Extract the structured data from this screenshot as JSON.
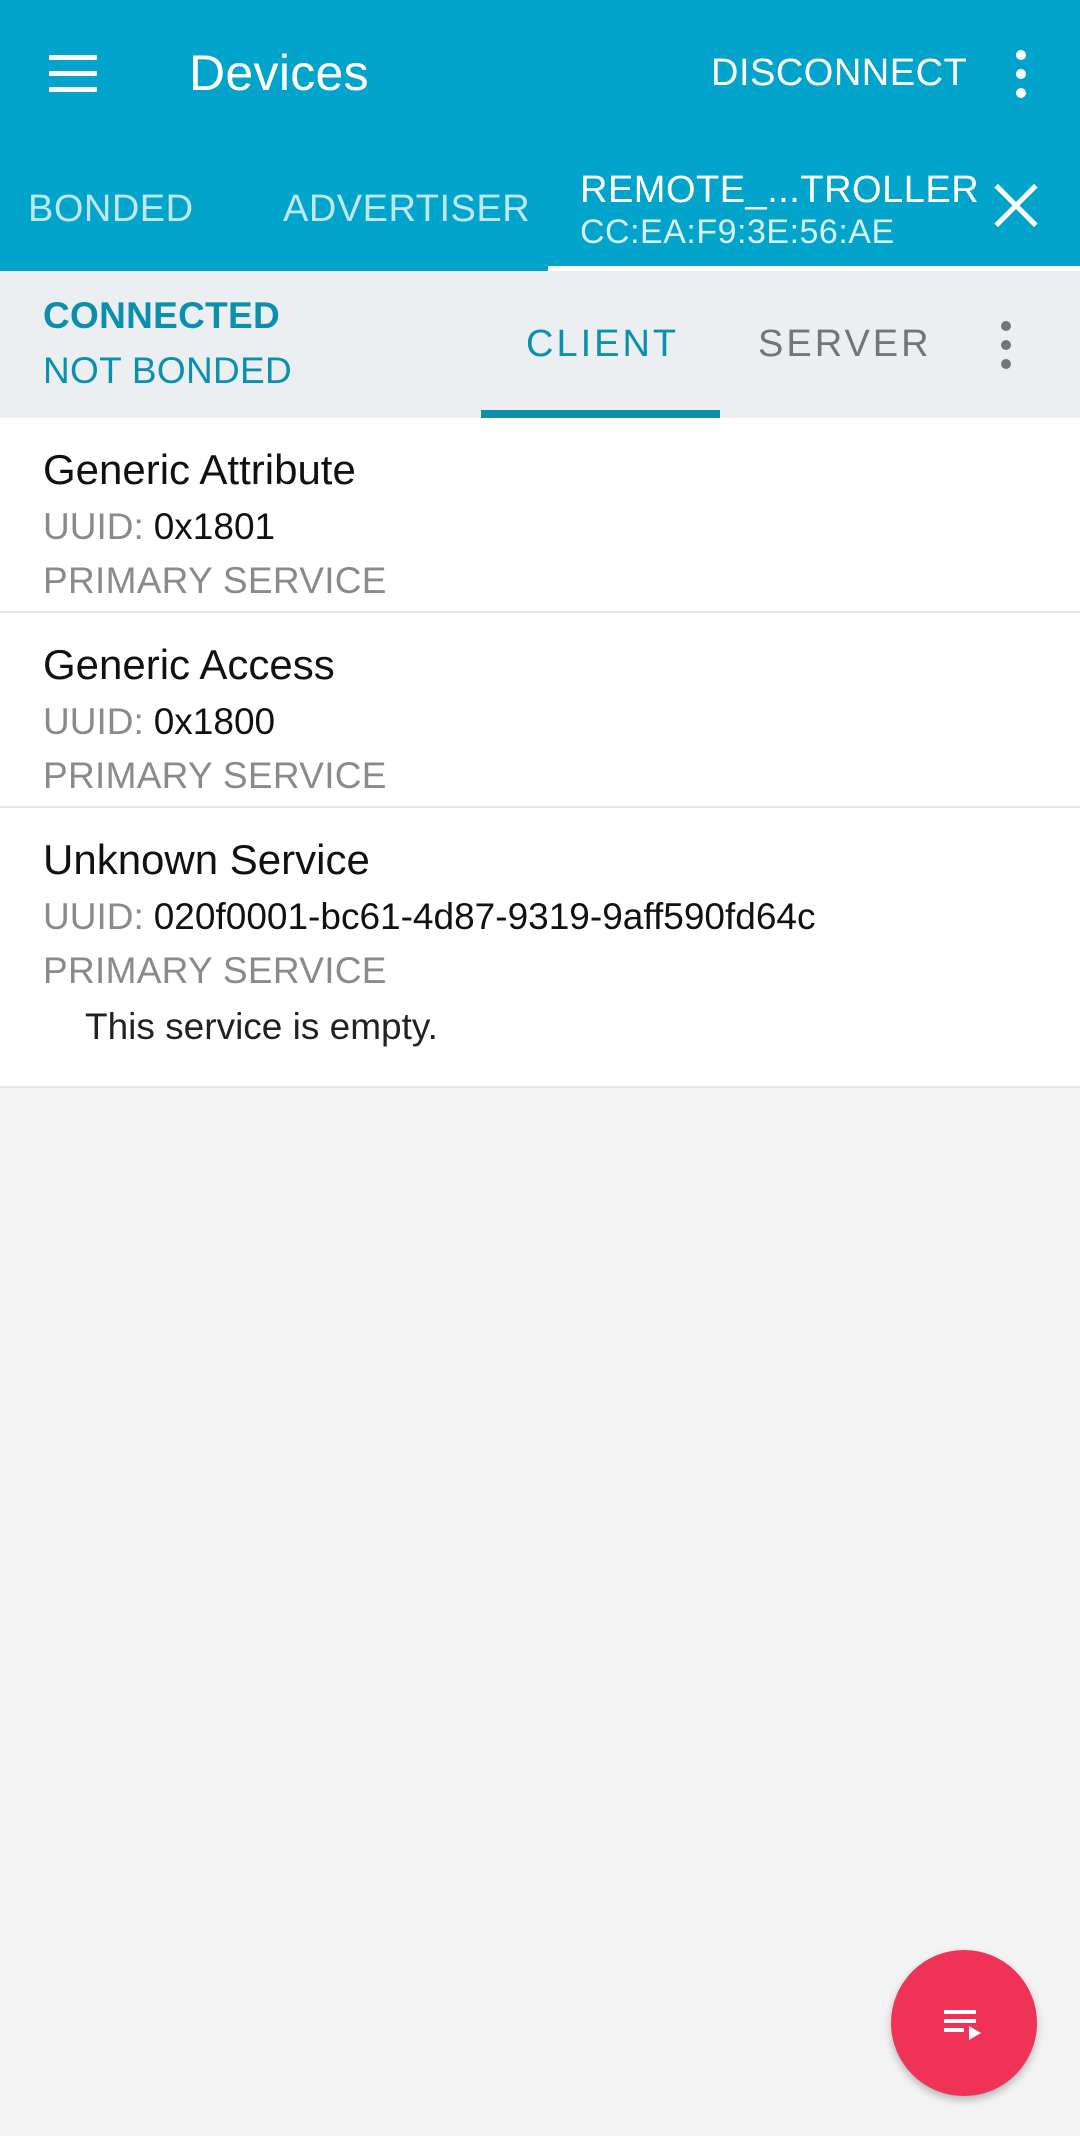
{
  "toolbar": {
    "title": "Devices",
    "disconnect_label": "DISCONNECT",
    "menu_icon": "hamburger-menu-icon",
    "overflow_icon": "more-vert-icon"
  },
  "tabs": {
    "bonded_label": "BONDED",
    "advertiser_label": "ADVERTISER",
    "device_name": "REMOTE_...TROLLER",
    "device_address": "CC:EA:F9:3E:56:AE",
    "close_icon": "close-icon"
  },
  "status": {
    "connection": "CONNECTED",
    "bond": "NOT BONDED"
  },
  "subtabs": {
    "client_label": "CLIENT",
    "server_label": "SERVER"
  },
  "services": [
    {
      "name": "Generic Attribute",
      "uuid_label": "UUID:",
      "uuid": "0x1801",
      "type": "PRIMARY SERVICE"
    },
    {
      "name": "Generic Access",
      "uuid_label": "UUID:",
      "uuid": "0x1800",
      "type": "PRIMARY SERVICE"
    },
    {
      "name": "Unknown Service",
      "uuid_label": "UUID:",
      "uuid": "020f0001-bc61-4d87-9319-9aff590fd64c",
      "type": "PRIMARY SERVICE",
      "note": "This service is empty."
    }
  ],
  "fab": {
    "icon": "playlist-play-icon"
  },
  "colors": {
    "primary": "#03a4cb",
    "accent_text": "#0b8fac",
    "fab": "#ef3256",
    "background": "#f3f3f4"
  }
}
